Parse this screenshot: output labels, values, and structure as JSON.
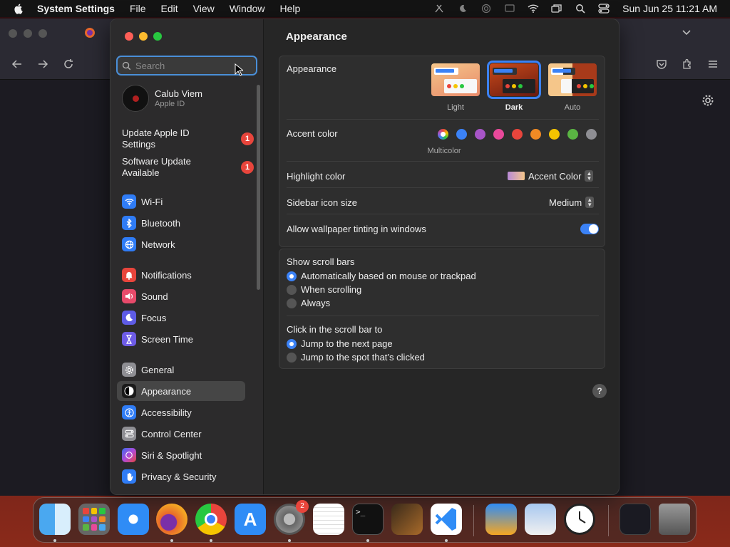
{
  "menubar": {
    "app_name": "System Settings",
    "menus": [
      "File",
      "Edit",
      "View",
      "Window",
      "Help"
    ],
    "clock": "Sun Jun 25  11:21 AM"
  },
  "search": {
    "placeholder": "Search"
  },
  "account": {
    "name": "Calub Viem",
    "subtitle": "Apple ID"
  },
  "notices": [
    {
      "label": "Update Apple ID Settings",
      "badge": "1"
    },
    {
      "label": "Software Update Available",
      "badge": "1"
    }
  ],
  "sidebar": {
    "items": [
      {
        "label": "Wi-Fi",
        "icon": "wifi-icon",
        "color": "#2f7cf6"
      },
      {
        "label": "Bluetooth",
        "icon": "bluetooth-icon",
        "color": "#2f7cf6"
      },
      {
        "label": "Network",
        "icon": "globe-icon",
        "color": "#2f7cf6"
      },
      {
        "label": "Notifications",
        "icon": "bell-icon",
        "color": "#e8453c"
      },
      {
        "label": "Sound",
        "icon": "speaker-icon",
        "color": "#e84a6a"
      },
      {
        "label": "Focus",
        "icon": "moon-icon",
        "color": "#5e5ce6"
      },
      {
        "label": "Screen Time",
        "icon": "hourglass-icon",
        "color": "#6e5ce6"
      },
      {
        "label": "General",
        "icon": "gear-icon",
        "color": "#8e8e93"
      },
      {
        "label": "Appearance",
        "icon": "appearance-icon",
        "color": "#1a1a1a"
      },
      {
        "label": "Accessibility",
        "icon": "accessibility-icon",
        "color": "#2f7cf6"
      },
      {
        "label": "Control Center",
        "icon": "control-center-icon",
        "color": "#8e8e93"
      },
      {
        "label": "Siri & Spotlight",
        "icon": "siri-icon",
        "color": "#b04ad8"
      },
      {
        "label": "Privacy & Security",
        "icon": "hand-icon",
        "color": "#2f7cf6"
      }
    ],
    "selected": "Appearance"
  },
  "main": {
    "title": "Appearance",
    "appearance_label": "Appearance",
    "appearance_options": [
      "Light",
      "Dark",
      "Auto"
    ],
    "appearance_selected": "Dark",
    "accent_label": "Accent color",
    "accent_caption": "Multicolor",
    "accent_colors": [
      "#3b82f6",
      "#a855c8",
      "#e8499a",
      "#e8453c",
      "#f08a24",
      "#f5c400",
      "#5ab543",
      "#8e8e93"
    ],
    "highlight_label": "Highlight color",
    "highlight_value": "Accent Color",
    "icon_size_label": "Sidebar icon size",
    "icon_size_value": "Medium",
    "tinting_label": "Allow wallpaper tinting in windows",
    "tinting_on": true,
    "scrollbars_label": "Show scroll bars",
    "scrollbars_options": [
      "Automatically based on mouse or trackpad",
      "When scrolling",
      "Always"
    ],
    "click_label": "Click in the scroll bar to",
    "click_options": [
      "Jump to the next page",
      "Jump to the spot that’s clicked"
    ],
    "help": "?"
  },
  "dock": {
    "settings_badge": "2"
  }
}
